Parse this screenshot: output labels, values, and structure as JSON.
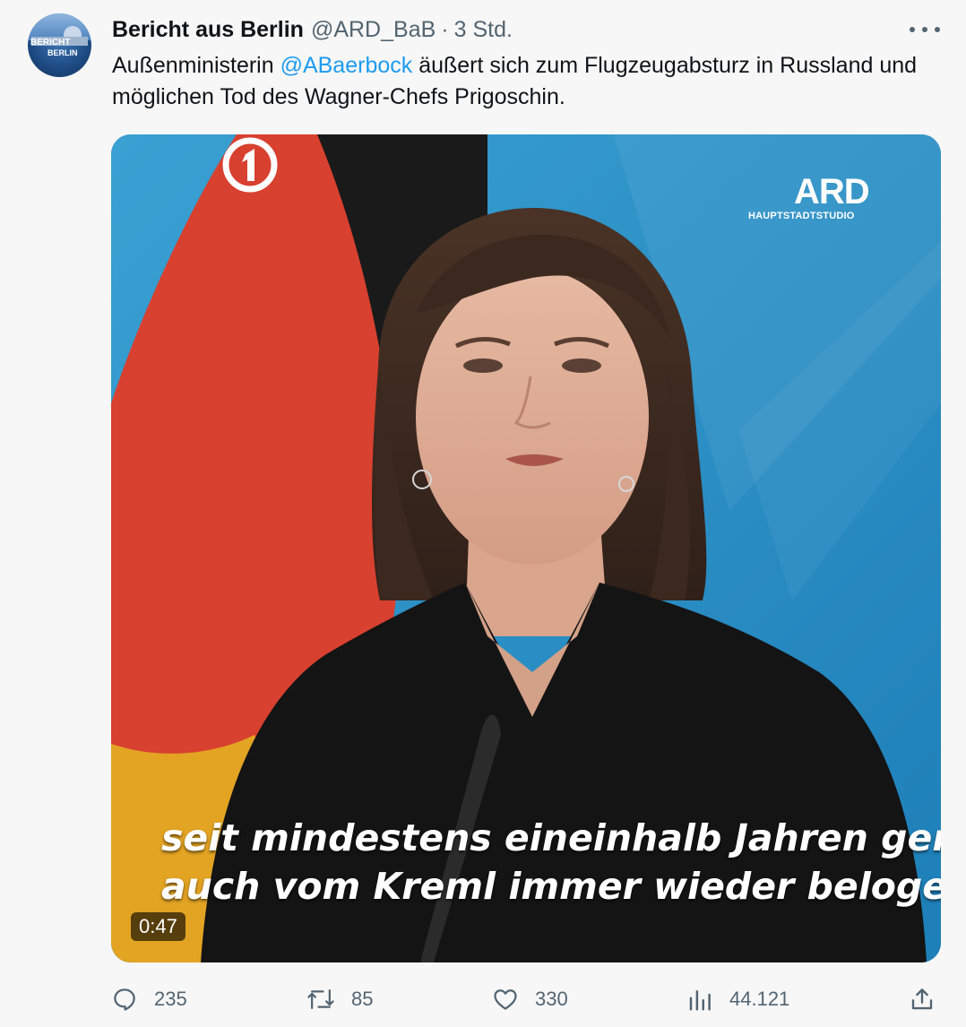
{
  "account": {
    "display_name": "Bericht aus Berlin",
    "handle": "@ARD_BaB",
    "separator": "·",
    "timestamp": "3 Std.",
    "avatar_text_line1": "BERICHT",
    "avatar_text_line2": "BERLIN"
  },
  "tweet": {
    "text_part1": "Außenministerin ",
    "mention": "@ABaerbock",
    "text_part2": " äußert sich zum Flugzeugabsturz in Russland und möglichen Tod des Wagner-Chefs Prigoschin."
  },
  "media": {
    "type": "video",
    "logo_text": "ARD",
    "logo_subtext": "HAUPTSTADTSTUDIO",
    "subtitle_line1": "seit mindestens eineinhalb Jahren gerade",
    "subtitle_line2": "auch vom Kreml immer wieder belogen",
    "duration": "0:47"
  },
  "actions": {
    "replies": "235",
    "retweets": "85",
    "likes": "330",
    "views": "44.121"
  },
  "icons": {
    "more": "more-icon",
    "reply": "reply-icon",
    "retweet": "retweet-icon",
    "like": "like-icon",
    "views": "views-icon",
    "share": "share-icon"
  },
  "colors": {
    "background": "#f7f7f7",
    "text": "#0f1419",
    "secondary_text": "#536471",
    "mention": "#1d9bf0",
    "video_background": "#2a8ec6"
  }
}
